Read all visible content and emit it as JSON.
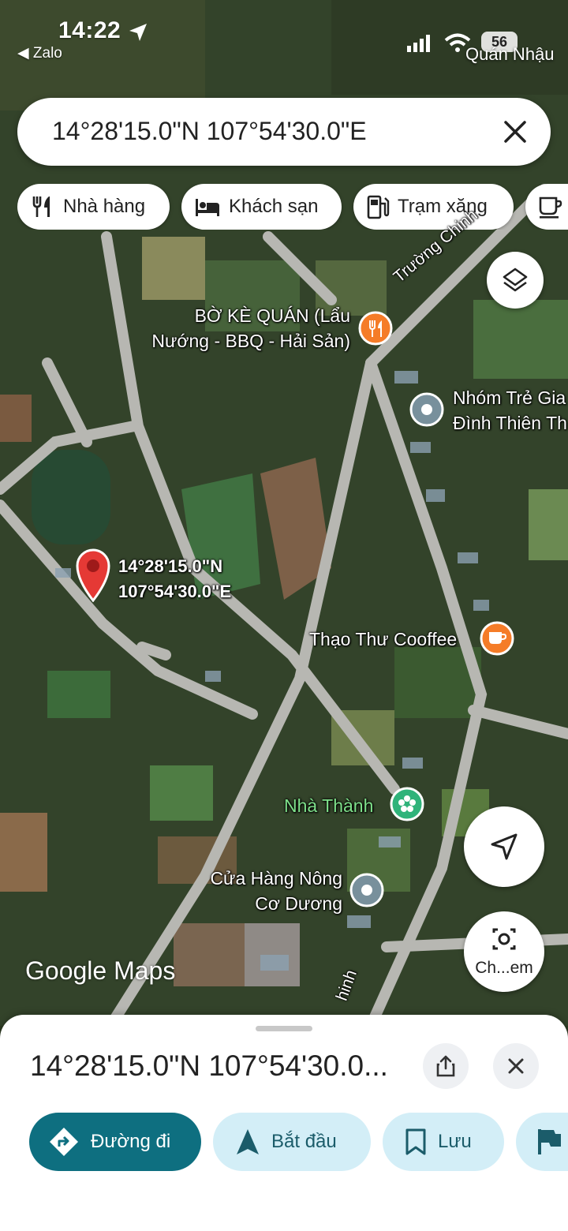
{
  "status": {
    "time": "14:22",
    "back_app": "◀ Zalo",
    "battery": "56",
    "top_right_label": "Quán Nhậu"
  },
  "search": {
    "query": "14°28'15.0\"N 107°54'30.0\"E"
  },
  "chips": [
    {
      "label": "Nhà hàng",
      "icon": "fork-knife-icon"
    },
    {
      "label": "Khách sạn",
      "icon": "bed-icon"
    },
    {
      "label": "Trạm xăng",
      "icon": "gas-station-icon"
    },
    {
      "label": "",
      "icon": "coffee-cup-icon"
    }
  ],
  "map": {
    "pin": {
      "line1": "14°28'15.0\"N",
      "line2": "107°54'30.0\"E",
      "color": "#e53935"
    },
    "road_label": "Trường Chinh",
    "road_label_bottom": "hinh",
    "places": [
      {
        "line1": "BỜ KÈ QUÁN (Lẩu",
        "line2": "Nướng - BBQ - Hải Sản)",
        "icon": "restaurant-icon",
        "color": "#f57c28"
      },
      {
        "line1": "Nhóm Trẻ Gia",
        "line2": "Đình Thiên Th",
        "icon": "place-icon",
        "color": "#78909c"
      },
      {
        "line1": "Thạo Thư Cooffee",
        "line2": "",
        "icon": "cafe-icon",
        "color": "#f57c28"
      },
      {
        "line1": "Nhà Thành",
        "line2": "",
        "icon": "flower-icon",
        "color": "#2fb37a"
      },
      {
        "line1": "Cửa Hàng Nông",
        "line2": "Cơ Dương",
        "icon": "place-icon",
        "color": "#78909c"
      }
    ],
    "watermark": {
      "google": "Google",
      "maps": "Maps"
    },
    "camera_label": "Ch...em"
  },
  "sheet": {
    "title": "14°28'15.0\"N 107°54'30.0...",
    "actions": [
      {
        "label": "Đường đi",
        "icon": "directions-icon"
      },
      {
        "label": "Bắt đầu",
        "icon": "navigation-arrow-icon"
      },
      {
        "label": "Lưu",
        "icon": "bookmark-icon"
      },
      {
        "label": "",
        "icon": "flag-icon"
      }
    ]
  },
  "colors": {
    "accent": "#0e6f80",
    "action_bg": "#d3eef7"
  }
}
